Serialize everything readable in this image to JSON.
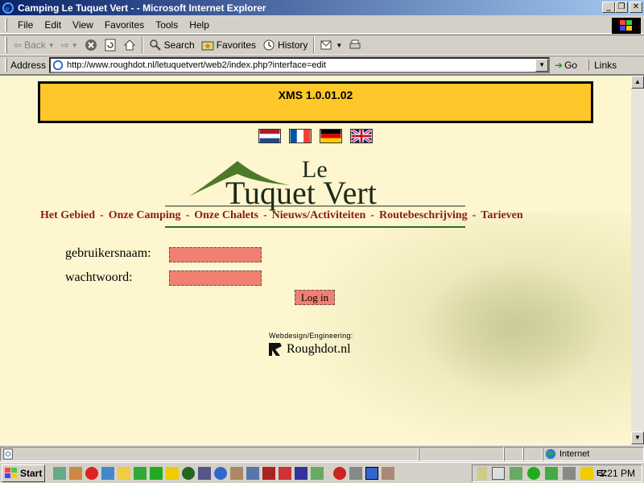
{
  "window": {
    "title": "Camping Le Tuquet Vert - - Microsoft Internet Explorer"
  },
  "menu": [
    "File",
    "Edit",
    "View",
    "Favorites",
    "Tools",
    "Help"
  ],
  "toolbar": {
    "back": "Back",
    "search": "Search",
    "favorites": "Favorites",
    "history": "History"
  },
  "address": {
    "label": "Address",
    "url": "http://www.roughdot.nl/letuquetvert/web2/index.php?interface=edit",
    "go": "Go",
    "links": "Links"
  },
  "page": {
    "banner": "XMS 1.0.01.02",
    "logo_le": "Le",
    "logo_main": "Tuquet Vert",
    "nav": [
      "Het Gebied",
      "Onze Camping",
      "Onze Chalets",
      "Nieuws/Activiteiten",
      "Routebeschrijving",
      "Tarieven"
    ],
    "nav_sep": "-",
    "username_label": "gebruikersnaam:",
    "password_label": "wachtwoord:",
    "login_button": "Log in",
    "credit_label": "Webdesign/Engineering:",
    "credit_name": "Roughdot.nl"
  },
  "status": {
    "zone": "Internet"
  },
  "taskbar": {
    "start": "Start",
    "clock": "1:21 PM",
    "tray_text": "EZ"
  },
  "colors": {
    "banner": "#ffc82a",
    "nav": "#8b1d12",
    "input": "#f08070",
    "page_bg": "#fdf6cf"
  }
}
